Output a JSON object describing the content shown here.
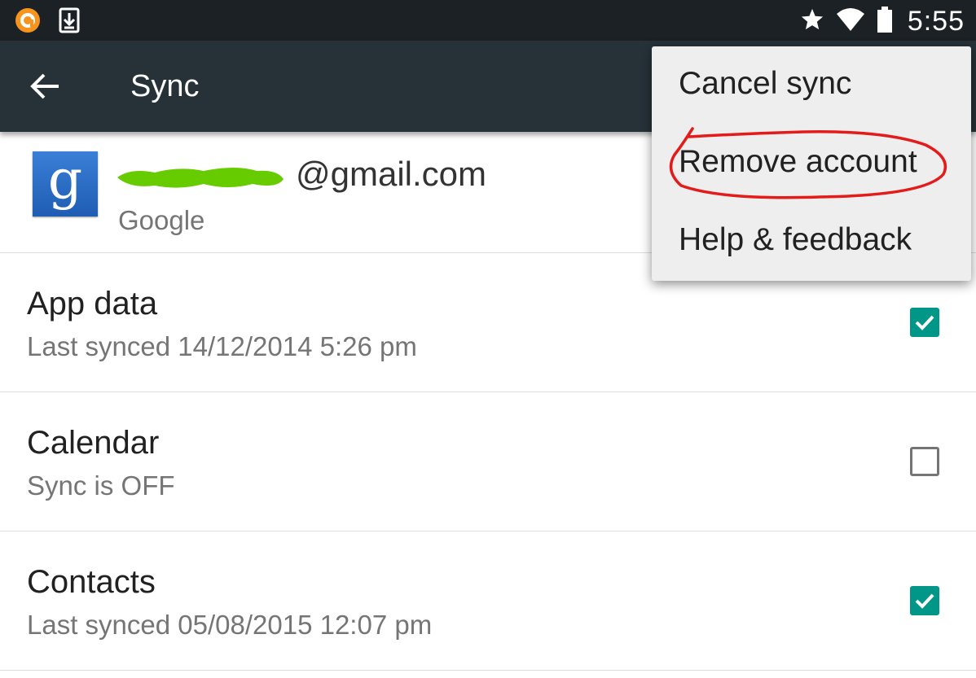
{
  "status_bar": {
    "time": "5:55",
    "icons": [
      "app-notification-icon",
      "download-icon",
      "star-icon",
      "wifi-icon",
      "battery-icon"
    ]
  },
  "app_bar": {
    "title": "Sync",
    "back_icon": "arrow-back-icon"
  },
  "account": {
    "logo_letter": "g",
    "email": "@gmail.com",
    "type": "Google"
  },
  "sync_items": [
    {
      "title": "App data",
      "subtitle": "Last synced 14/12/2014 5:26 pm",
      "checked": true
    },
    {
      "title": "Calendar",
      "subtitle": "Sync is OFF",
      "checked": false
    },
    {
      "title": "Contacts",
      "subtitle": "Last synced 05/08/2015 12:07 pm",
      "checked": true
    }
  ],
  "menu": {
    "items": [
      {
        "label": "Cancel sync"
      },
      {
        "label": "Remove account"
      },
      {
        "label": "Help & feedback"
      }
    ],
    "highlighted_item": "Remove account"
  },
  "colors": {
    "status_bar": "#1c2125",
    "app_bar": "#263238",
    "accent": "#009688",
    "annotation": "#e31b1b",
    "redaction": "#66cc00"
  }
}
